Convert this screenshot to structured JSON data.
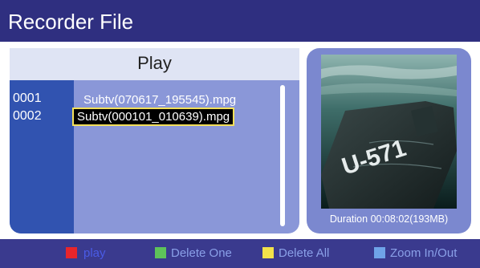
{
  "header": {
    "title": "Recorder File"
  },
  "list": {
    "heading": "Play",
    "indices": [
      "0001",
      "0002"
    ],
    "files": [
      "Subtv(070617_195545).mpg",
      "Subtv(000101_010639).mpg"
    ],
    "selected_index": 1
  },
  "preview": {
    "image": "u-571-movie-poster",
    "poster_text": "U-571",
    "duration": "Duration  00:08:02(193MB)"
  },
  "legend": {
    "keys": [
      {
        "label": "play",
        "color": "#e8252b",
        "text_color": "#4a5be6",
        "icon": "red-key-icon"
      },
      {
        "label": "Delete One",
        "color": "#5ec25a",
        "text_color": "#8aa0e8",
        "icon": "green-key-icon"
      },
      {
        "label": "Delete All",
        "color": "#f2e24a",
        "text_color": "#8aa0e8",
        "icon": "yellow-key-icon"
      },
      {
        "label": "Zoom In/Out",
        "color": "#6fa3e8",
        "text_color": "#8aa0e8",
        "icon": "blue-key-icon"
      }
    ]
  },
  "colors": {
    "background": "#3a3a8e",
    "header": "#2f2f80",
    "list_panel": "#8a97d8",
    "index_column": "#3153b0",
    "selection_border": "#f3e05a"
  }
}
